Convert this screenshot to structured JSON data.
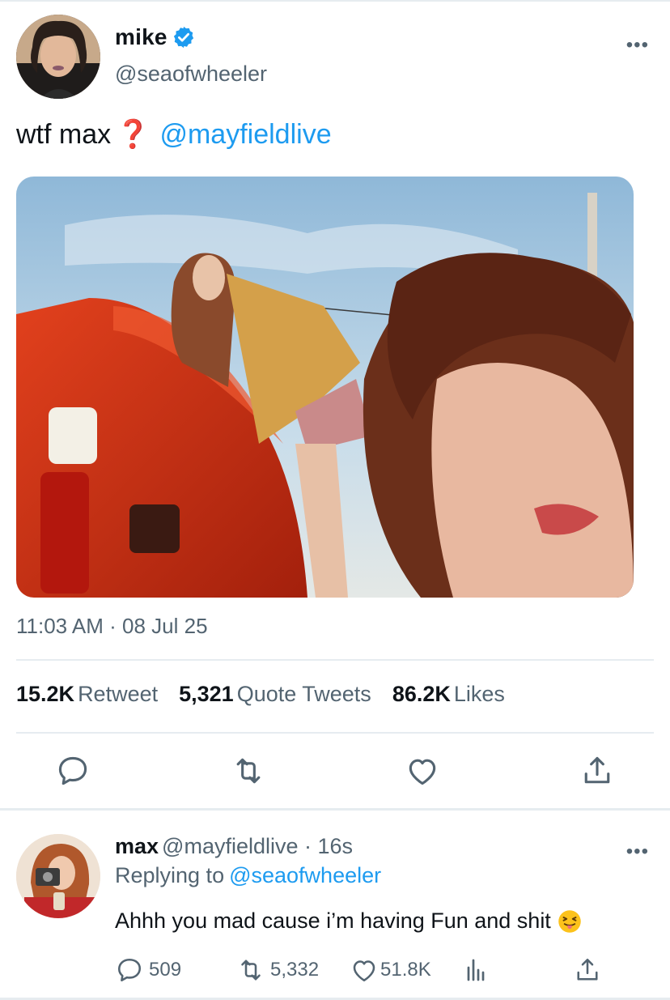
{
  "tweet": {
    "display_name": "mike",
    "handle": "@seaofwheeler",
    "more": "•••",
    "text": "wtf max",
    "text_mark": "❓",
    "mention": "@mayfieldlive",
    "timestamp": "11:03 AM · 08 Jul 25",
    "stats": {
      "retweets_count": "15.2K",
      "retweets_label": "Retweet",
      "quotes_count": "5,321",
      "quotes_label": "Quote Tweets",
      "likes_count": "86.2K",
      "likes_label": "Likes"
    },
    "actions": [
      "reply-icon",
      "retweet-icon",
      "heart-icon",
      "share-icon"
    ]
  },
  "reply": {
    "display_name": "max",
    "meta": "@mayfieldlive · 16s",
    "more": "•••",
    "replying_label": "Replying to",
    "replying_handle": "@seaofwheeler",
    "text": "Ahhh you mad cause i’m having Fun and shit",
    "emoji": "squinting-face-with-tongue",
    "counts": {
      "replies": "509",
      "retweets": "5,332",
      "likes": "51.8K"
    }
  },
  "colors": {
    "accent": "#1d9bf0",
    "text": "#0f1419",
    "secondary": "#536471",
    "divider": "#e6ecf0"
  }
}
